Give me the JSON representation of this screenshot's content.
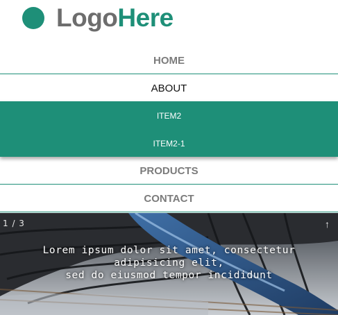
{
  "logo": {
    "part1": "Logo",
    "part2": "Here",
    "dot_color": "#1e8f78"
  },
  "nav": {
    "items": [
      {
        "label": "HOME"
      },
      {
        "label": "ABOUT"
      },
      {
        "label": "PRODUCTS"
      },
      {
        "label": "CONTACT"
      }
    ],
    "submenu": [
      {
        "label": "ITEM2"
      },
      {
        "label": "ITEM2-1"
      }
    ],
    "accent": "#1e8f78"
  },
  "hero": {
    "counter": "1 / 3",
    "arrow": "↑",
    "caption": [
      "Lorem ipsum dolor sit amet, consectetur",
      "adipisicing elit,",
      "sed do eiusmod tempor incididunt"
    ]
  }
}
